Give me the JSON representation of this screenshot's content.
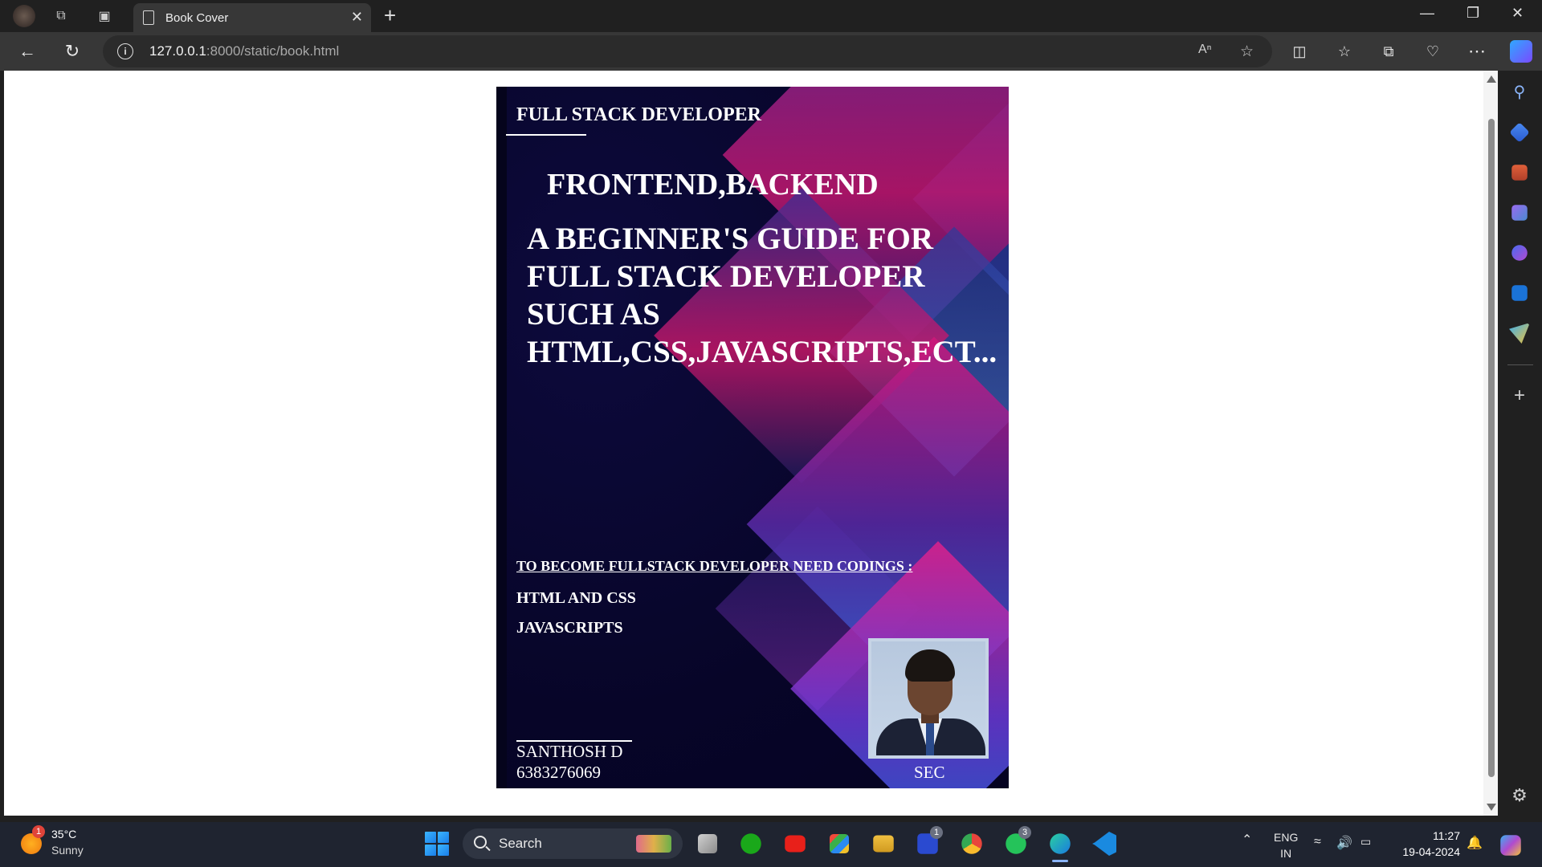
{
  "browser": {
    "tab_title": "Book Cover",
    "url_host": "127.0.0.1",
    "url_path": ":8000/static/book.html"
  },
  "cover": {
    "heading": "FULL STACK DEVELOPER",
    "subtitle": "FRONTEND,BACKEND",
    "title_lines": [
      "A BEGINNER'S GUIDE FOR",
      "FULL STACK DEVELOPER",
      "SUCH AS",
      "HTML,CSS,JAVASCRIPTS,ECT..."
    ],
    "need_text": "TO BECOME FULLSTACK DEVELOPER NEED CODINGS :",
    "items": [
      "HTML AND CSS",
      "JAVASCRIPTS"
    ],
    "author": "SANTHOSH D",
    "phone": "6383276069",
    "institution": "SEC"
  },
  "taskbar": {
    "weather_temp": "35°C",
    "weather_cond": "Sunny",
    "weather_badge": "1",
    "search_label": "Search",
    "badge_l": "1",
    "badge_whatsapp": "3",
    "lang_line1": "ENG",
    "lang_line2": "IN",
    "time": "11:27",
    "date": "19-04-2024"
  }
}
